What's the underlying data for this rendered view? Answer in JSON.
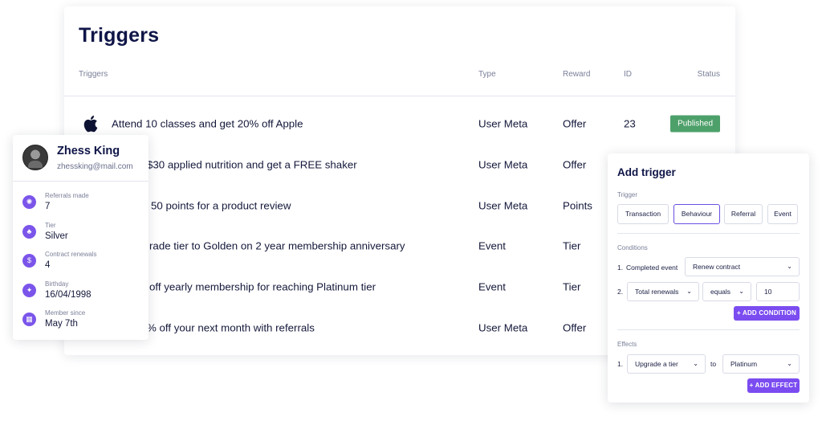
{
  "triggers": {
    "title": "Triggers",
    "columns": {
      "name": "Triggers",
      "type": "Type",
      "reward": "Reward",
      "id": "ID",
      "status": "Status"
    },
    "rows": [
      {
        "name": "Attend 10 classes and get 20% off Apple",
        "type": "User Meta",
        "reward": "Offer",
        "id": "23",
        "status": "Published",
        "icon": "apple-icon"
      },
      {
        "name": "$30 applied nutrition and get a FREE shaker",
        "type": "User Meta",
        "reward": "Offer",
        "id": "",
        "status": ""
      },
      {
        "name": "50 points for a product review",
        "type": "User Meta",
        "reward": "Points",
        "id": "",
        "status": ""
      },
      {
        "name": "rade tier to Golden on 2 year membership anniversary",
        "type": "Event",
        "reward": "Tier",
        "id": "",
        "status": ""
      },
      {
        "name": "off yearly membership for reaching Platinum tier",
        "type": "Event",
        "reward": "Tier",
        "id": "",
        "status": ""
      },
      {
        "name": "% off your next month with referrals",
        "type": "User Meta",
        "reward": "Offer",
        "id": "",
        "status": ""
      }
    ]
  },
  "profile": {
    "name": "Zhess King",
    "email": "zhessking@mail.com",
    "stats": [
      {
        "label": "Referrals made",
        "value": "7",
        "icon": "referral-icon"
      },
      {
        "label": "Tier",
        "value": "Silver",
        "icon": "tier-icon"
      },
      {
        "label": "Contract renewals",
        "value": "4",
        "icon": "dollar-icon"
      },
      {
        "label": "Birthday",
        "value": "16/04/1998",
        "icon": "party-icon"
      },
      {
        "label": "Member since",
        "value": "May 7th",
        "icon": "calendar-icon"
      }
    ]
  },
  "add_trigger": {
    "title": "Add trigger",
    "trigger_label": "Trigger",
    "trigger_options": [
      "Transaction",
      "Behaviour",
      "Referral",
      "Event"
    ],
    "trigger_selected": "Behaviour",
    "conditions_label": "Conditions",
    "condition_1": {
      "num": "1.",
      "text": "Completed event",
      "select": "Renew contract"
    },
    "condition_2": {
      "num": "2.",
      "field": "Total renewals",
      "operator": "equals",
      "value": "10"
    },
    "add_condition": "+ ADD CONDITION",
    "effects_label": "Effects",
    "effect_1": {
      "num": "1.",
      "action": "Upgrade a tier",
      "to": "to",
      "target": "Platinum"
    },
    "add_effect": "+ ADD EFFECT"
  },
  "colors": {
    "accent": "#7b4cf0",
    "published": "#4ea06a",
    "title": "#0f1547"
  }
}
